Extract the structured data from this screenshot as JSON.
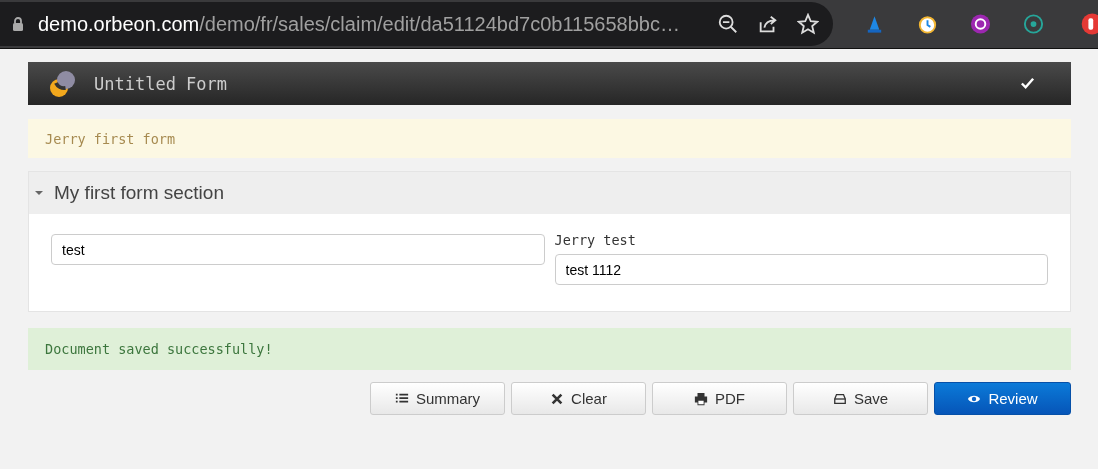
{
  "browser": {
    "url_host": "demo.orbeon.com",
    "url_path": "/demo/fr/sales/claim/edit/da51124bd7c0b115658bbc…"
  },
  "form_header": {
    "title": "Untitled Form"
  },
  "description": "Jerry first form",
  "section": {
    "title": "My first form section",
    "expanded": true,
    "fields": [
      {
        "value": "test"
      },
      {
        "label": "Jerry test",
        "value": "test 1112"
      }
    ]
  },
  "message": "Document saved successfully!",
  "buttons": [
    {
      "label": "Summary",
      "kind": "default"
    },
    {
      "label": "Clear",
      "kind": "default"
    },
    {
      "label": "PDF",
      "kind": "default"
    },
    {
      "label": "Save",
      "kind": "default"
    },
    {
      "label": "Review",
      "kind": "primary"
    }
  ]
}
